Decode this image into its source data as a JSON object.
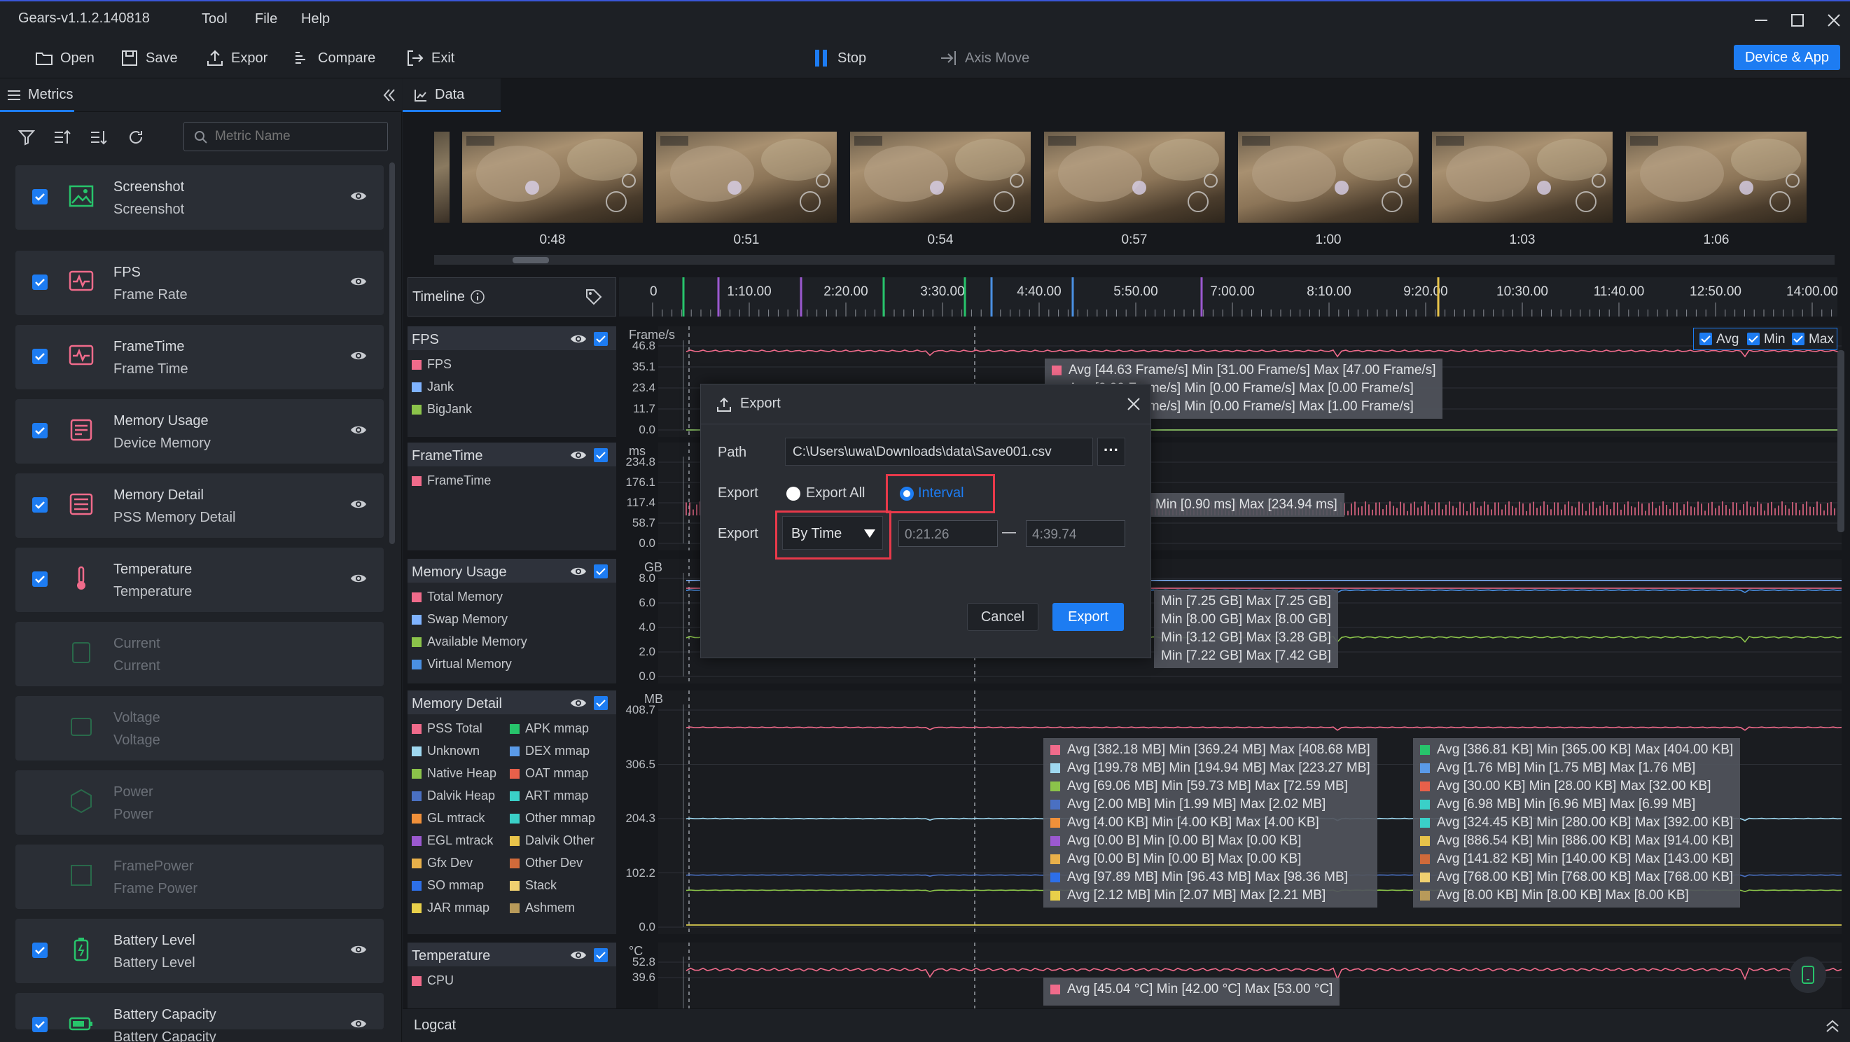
{
  "app": {
    "title": "Gears-v1.1.2.140818",
    "menus": [
      "Tool",
      "File",
      "Help"
    ]
  },
  "toolbar": {
    "open": "Open",
    "save": "Save",
    "export": "Expor",
    "compare": "Compare",
    "exit": "Exit",
    "stop": "Stop",
    "axis_move": "Axis Move",
    "device_app": "Device & App"
  },
  "metrics_panel": {
    "tab": "Metrics",
    "search_placeholder": "Metric Name",
    "items": [
      {
        "name": "Screenshot",
        "sub": "Screenshot",
        "checked": true,
        "icon": "image-icon"
      },
      {
        "name": "FPS",
        "sub": "Frame Rate",
        "checked": true,
        "icon": "pulse-icon"
      },
      {
        "name": "FrameTime",
        "sub": "Frame Time",
        "checked": true,
        "icon": "pulse-icon"
      },
      {
        "name": "Memory Usage",
        "sub": "Device Memory",
        "checked": true,
        "icon": "memory-icon"
      },
      {
        "name": "Memory Detail",
        "sub": "PSS Memory Detail",
        "checked": true,
        "icon": "list-icon"
      },
      {
        "name": "Temperature",
        "sub": "Temperature",
        "checked": true,
        "icon": "thermometer-icon"
      },
      {
        "name": "Current",
        "sub": "Current",
        "checked": false,
        "icon": "current-icon"
      },
      {
        "name": "Voltage",
        "sub": "Voltage",
        "checked": false,
        "icon": "voltage-icon"
      },
      {
        "name": "Power",
        "sub": "Power",
        "checked": false,
        "icon": "power-icon"
      },
      {
        "name": "FramePower",
        "sub": "Frame Power",
        "checked": false,
        "icon": "framepower-icon"
      },
      {
        "name": "Battery Level",
        "sub": "Battery Level",
        "checked": true,
        "icon": "battery-icon"
      },
      {
        "name": "Battery Capacity",
        "sub": "Battery Capacity",
        "checked": true,
        "icon": "battery-h-icon"
      }
    ]
  },
  "data_panel": {
    "tab": "Data",
    "screenshot_times": [
      "0:48",
      "0:51",
      "0:54",
      "0:57",
      "1:00",
      "1:03",
      "1:06"
    ],
    "timeline": {
      "label": "Timeline",
      "ticks": [
        "0",
        "1:10.00",
        "2:20.00",
        "3:30.00",
        "4:40.00",
        "5:50.00",
        "7:00.00",
        "8:10.00",
        "9:20.00",
        "10:30.00",
        "11:40.00",
        "12:50.00",
        "14:00.00"
      ]
    },
    "toggles": {
      "avg": "Avg",
      "min": "Min",
      "max": "Max"
    },
    "colors": {
      "pink": "#f06b8b",
      "blue": "#4a90e2",
      "green": "#8bc34a",
      "accent": "#1d7cf2",
      "red": "#e8394a"
    },
    "groups": {
      "fps": {
        "title": "FPS",
        "unit": "Frame/s",
        "legend": [
          "FPS",
          "Jank",
          "BigJank"
        ],
        "yticks": [
          "46.8",
          "35.1",
          "23.4",
          "11.7",
          "0.0"
        ],
        "tips": [
          "Avg [44.63 Frame/s]  Min [31.00 Frame/s]  Max [47.00 Frame/s]",
          "Avg [0.00 Frame/s]  Min [0.00 Frame/s]  Max [0.00 Frame/s]",
          "Avg [0.06 Frame/s]  Min [0.00 Frame/s]  Max [1.00 Frame/s]"
        ]
      },
      "frametime": {
        "title": "FrameTime",
        "unit": "ms",
        "legend": [
          "FrameTime"
        ],
        "yticks": [
          "234.8",
          "176.1",
          "117.4",
          "58.7",
          "0.0"
        ],
        "tips": [
          "Min [0.90 ms]  Max [234.94 ms]"
        ]
      },
      "memory_usage": {
        "title": "Memory Usage",
        "unit": "GB",
        "legend": [
          "Total Memory",
          "Swap Memory",
          "Available Memory",
          "Virtual Memory"
        ],
        "yticks": [
          "8.0",
          "6.0",
          "4.0",
          "2.0",
          "0.0"
        ],
        "tips": [
          "Min [7.25 GB]  Max [7.25 GB]",
          "Min [8.00 GB]  Max [8.00 GB]",
          "Min [3.12 GB]  Max [3.28 GB]",
          "Min [7.22 GB]  Max [7.42 GB]"
        ]
      },
      "memory_detail": {
        "title": "Memory Detail",
        "unit": "MB",
        "yticks": [
          "408.7",
          "306.5",
          "204.3",
          "102.2",
          "0.0"
        ],
        "legend_left": [
          "PSS Total",
          "Unknown",
          "Native Heap",
          "Dalvik Heap",
          "GL mtrack",
          "EGL mtrack",
          "Gfx Dev",
          "SO mmap",
          "JAR mmap"
        ],
        "legend_right": [
          "APK mmap",
          "DEX mmap",
          "OAT mmap",
          "ART mmap",
          "Other mmap",
          "Dalvik Other",
          "Other Dev",
          "Stack",
          "Ashmem"
        ],
        "tips_left": [
          "Avg [382.18 MB]  Min [369.24 MB]  Max [408.68 MB]",
          "Avg [199.78 MB]  Min [194.94 MB]  Max [223.27 MB]",
          "Avg [69.06 MB]  Min [59.73 MB]  Max [72.59 MB]",
          "Avg [2.00 MB]  Min [1.99 MB]  Max [2.02 MB]",
          "Avg [4.00 KB]  Min [4.00 KB]  Max [4.00 KB]",
          "Avg [0.00 B]  Min [0.00 B]  Max [0.00 KB]",
          "Avg [0.00 B]  Min [0.00 B]  Max [0.00 KB]",
          "Avg [97.89 MB]  Min [96.43 MB]  Max [98.36 MB]",
          "Avg [2.12 MB]  Min [2.07 MB]  Max [2.21 MB]"
        ],
        "tips_right": [
          "Avg [386.81 KB]  Min [365.00 KB]  Max [404.00 KB]",
          "Avg [1.76 MB]  Min [1.75 MB]  Max [1.76 MB]",
          "Avg [30.00 KB]  Min [28.00 KB]  Max [32.00 KB]",
          "Avg [6.98 MB]  Min [6.96 MB]  Max [6.99 MB]",
          "Avg [324.45 KB]  Min [280.00 KB]  Max [392.00 KB]",
          "Avg [886.54 KB]  Min [886.00 KB]  Max [914.00 KB]",
          "Avg [141.82 KB]  Min [140.00 KB]  Max [143.00 KB]",
          "Avg [768.00 KB]  Min [768.00 KB]  Max [768.00 KB]",
          "Avg [8.00 KB]  Min [8.00 KB]  Max [8.00 KB]"
        ]
      },
      "temperature": {
        "title": "Temperature",
        "unit": "°C",
        "legend": [
          "CPU"
        ],
        "yticks": [
          "52.8",
          "39.6"
        ],
        "tips": [
          "Avg [45.04 °C]  Min [42.00 °C]  Max [53.00 °C]"
        ]
      }
    },
    "logcat": "Logcat"
  },
  "export_dialog": {
    "title": "Export",
    "path_label": "Path",
    "path_value": "C:\\Users\\uwa\\Downloads\\data\\Save001.csv",
    "more": "···",
    "export_label": "Export",
    "option_all": "Export All",
    "option_interval": "Interval",
    "export_label2": "Export",
    "mode": "By Time",
    "start": "0:21.26",
    "dash": "—",
    "end": "4:39.74",
    "cancel": "Cancel",
    "confirm": "Export"
  }
}
